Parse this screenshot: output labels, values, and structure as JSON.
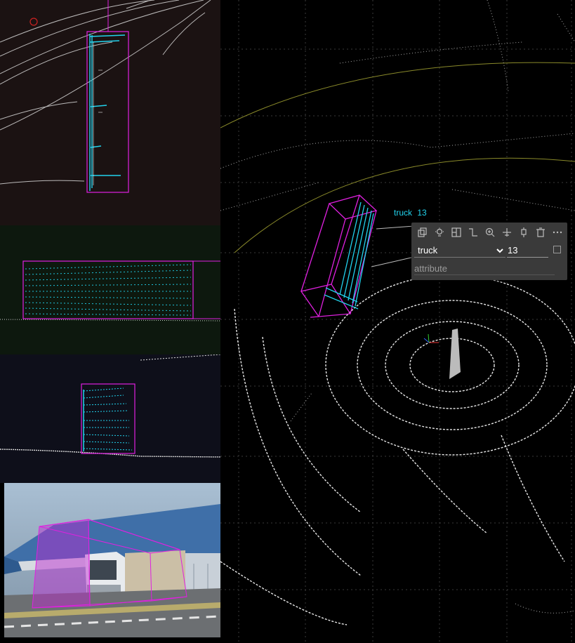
{
  "views": {
    "top": {
      "name": "top-view"
    },
    "side": {
      "name": "side-view"
    },
    "front": {
      "name": "front-view"
    },
    "camera": {
      "name": "camera-image"
    }
  },
  "object_label": {
    "class": "truck",
    "track_id": "13"
  },
  "panel": {
    "tools": [
      {
        "name": "copy-icon"
      },
      {
        "name": "bulb-icon"
      },
      {
        "name": "grid-icon"
      },
      {
        "name": "path-icon"
      },
      {
        "name": "zoom-icon"
      },
      {
        "name": "move-icon"
      },
      {
        "name": "pin-icon"
      },
      {
        "name": "trash-icon"
      },
      {
        "name": "more-icon"
      }
    ],
    "class_options": [
      "truck"
    ],
    "class_value": "truck",
    "track_value": "13",
    "attribute_placeholder": "attribute"
  },
  "colors": {
    "box": "#e020e0",
    "points_highlight": "#22d3ee",
    "points": "#e6e6e6",
    "panel_bg": "#3a3a3a",
    "grid": "#2f2f2f"
  }
}
